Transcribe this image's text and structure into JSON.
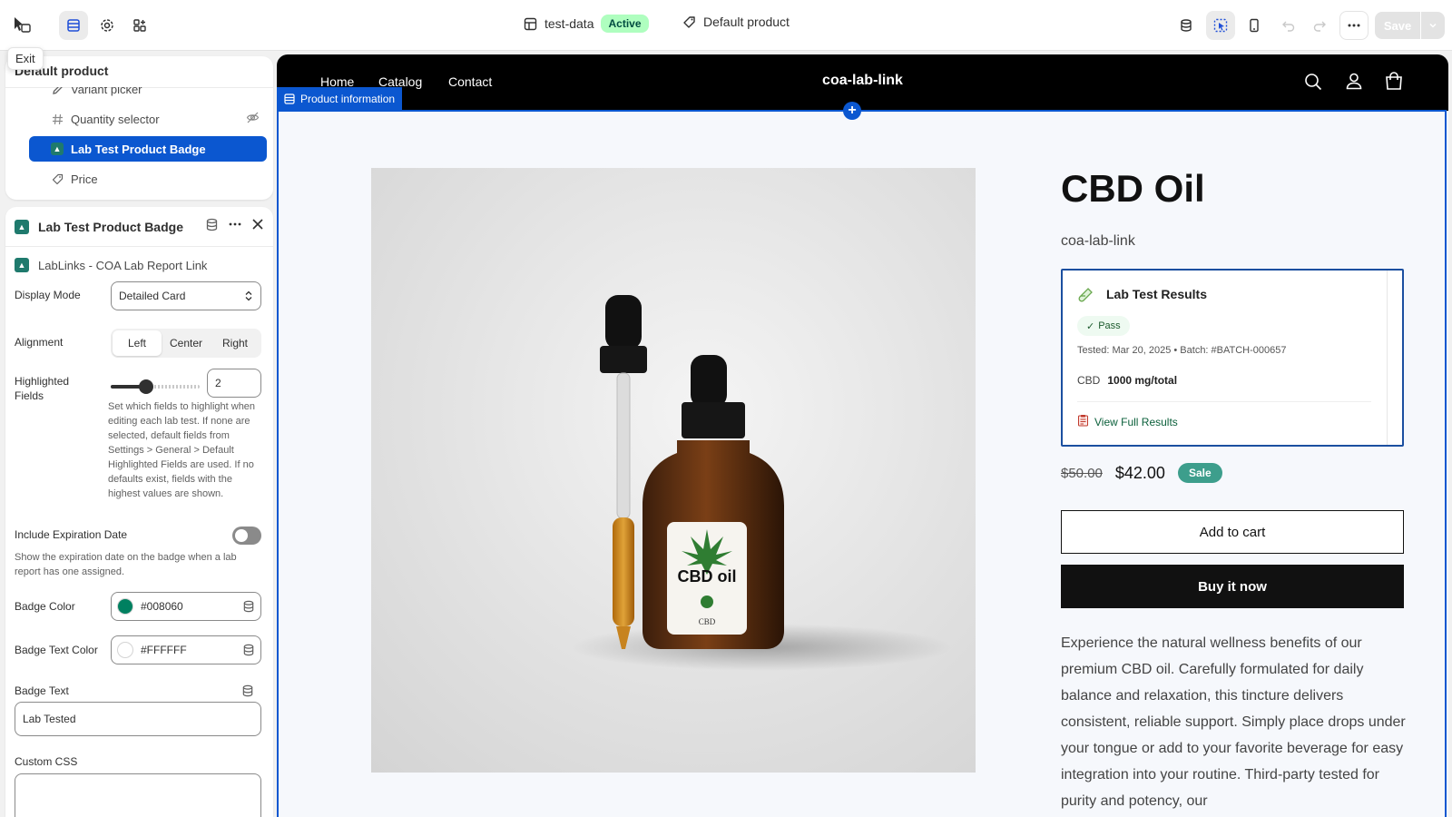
{
  "topbar": {
    "exit_tooltip": "Exit",
    "theme_name": "test-data",
    "theme_status": "Active",
    "template_name": "Default product",
    "save_label": "Save"
  },
  "sidebar": {
    "title": "Default product",
    "items": [
      {
        "label": "Variant picker",
        "icon": "pencil-icon"
      },
      {
        "label": "Quantity selector",
        "icon": "hash-icon"
      },
      {
        "label": "Lab Test Product Badge",
        "icon": "app-icon"
      },
      {
        "label": "Price",
        "icon": "tag-icon"
      }
    ]
  },
  "settings": {
    "block_title": "Lab Test Product Badge",
    "app_name": "LabLinks - COA Lab Report Link",
    "display_mode_label": "Display Mode",
    "display_mode_value": "Detailed Card",
    "alignment_label": "Alignment",
    "alignment_options": [
      "Left",
      "Center",
      "Right"
    ],
    "alignment_selected": "Left",
    "highlighted_fields_label": "Highlighted Fields",
    "highlighted_fields_value": "2",
    "highlighted_fields_level": 0.4,
    "highlighted_fields_help": "Set which fields to highlight when editing each lab test. If none are selected, default fields from Settings > General > Default Highlighted Fields are used. If no defaults exist, fields with the highest values are shown.",
    "expiration_label": "Include Expiration Date",
    "expiration_enabled": false,
    "expiration_help": "Show the expiration date on the badge when a lab report has one assigned.",
    "badge_color_label": "Badge Color",
    "badge_color_value": "#008060",
    "badge_text_color_label": "Badge Text Color",
    "badge_text_color_value": "#FFFFFF",
    "badge_text_label": "Badge Text",
    "badge_text_value": "Lab Tested",
    "custom_css_label": "Custom CSS",
    "custom_css_value": ""
  },
  "store": {
    "nav_links": [
      "Home",
      "Catalog",
      "Contact"
    ],
    "brand": "coa-lab-link",
    "section_tag": "Product information"
  },
  "product": {
    "title": "CBD Oil",
    "vendor": "coa-lab-link",
    "lab_card": {
      "title": "Lab Test Results",
      "status": "Pass",
      "meta": "Tested: Mar 20, 2025 • Batch: #BATCH-000657",
      "cannabinoid_label": "CBD",
      "cannabinoid_value": "1000 mg/total",
      "link_label": "View Full Results"
    },
    "price_old": "$50.00",
    "price_new": "$42.00",
    "sale_label": "Sale",
    "add_to_cart": "Add to cart",
    "buy_now": "Buy it now",
    "description": "Experience the natural wellness benefits of our premium CBD oil. Carefully formulated for daily balance and relaxation, this tincture delivers consistent, reliable support. Simply place drops under your tongue or add to your favorite beverage for easy integration into your routine. Third-party tested for purity and potency, our",
    "image_label_main": "CBD oil",
    "image_label_sub": "CBD"
  },
  "colors": {
    "accent": "#0b57d0",
    "badge_color": "#008060",
    "sale_badge": "#3d9e8c"
  }
}
